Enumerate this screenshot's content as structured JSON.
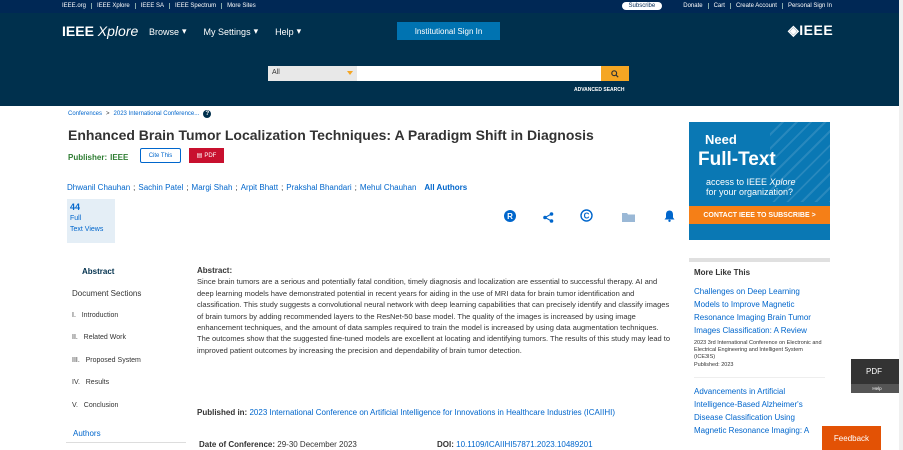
{
  "util_bar": {
    "links": [
      "IEEE.org",
      "IEEE Xplore",
      "IEEE SA",
      "IEEE Spectrum",
      "More Sites"
    ],
    "subscribe": "Subscribe",
    "right_links": [
      "Donate",
      "Cart",
      "Create Account",
      "Personal Sign In"
    ]
  },
  "header": {
    "logo_main": "IEEE ",
    "logo_italic": "Xplore",
    "nav": [
      "Browse",
      "My Settings",
      "Help"
    ],
    "institutional_sign_in": "Institutional Sign In",
    "brand": "◈IEEE"
  },
  "search": {
    "scope": "All",
    "placeholder": "",
    "advanced": "ADVANCED SEARCH"
  },
  "breadcrumb": [
    "Conferences",
    ">",
    "2023 International Conference..."
  ],
  "article": {
    "title": "Enhanced Brain Tumor Localization Techniques: A Paradigm Shift in Diagnosis",
    "publisher_label": "Publisher:",
    "publisher": "IEEE",
    "cite_this": "Cite This",
    "pdf": "PDF",
    "authors": [
      "Dhwanil Chauhan",
      "Sachin Patel",
      "Margi Shah",
      "Arpit Bhatt",
      "Prakshal Bhandari",
      "Mehul Chauhan"
    ],
    "all_authors": "All Authors",
    "views_count": "44",
    "views_label1": "Full",
    "views_label2": "Text Views"
  },
  "ad": {
    "line1": "Need",
    "line2": "Full-Text",
    "line3a": "access to IEEE",
    "line3b": "Xplore",
    "line4": "for your organization?",
    "cta": "CONTACT IEEE TO SUBSCRIBE >"
  },
  "left_nav": {
    "abstract": "Abstract",
    "doc_sections": "Document Sections",
    "sections": [
      "I.   Introduction",
      "II.   Related Work",
      "III.   Proposed System",
      "IV.   Results",
      "V.   Conclusion"
    ],
    "authors": "Authors"
  },
  "abstract": {
    "heading": "Abstract:",
    "text": "Since brain tumors are a serious and potentially fatal condition, timely diagnosis and localization are essential to successful therapy. AI and deep learning models have demonstrated potential in recent years for aiding in the use of MRI data for brain tumor identification and classification. This study suggests a convolutional neural network with deep learning capabilities that can precisely identify and classify images of brain tumors by adding recommended layers to the ResNet-50 base model. The quality of the images is increased by using image enhancement techniques, and the amount of data samples required to train the model is increased by using data augmentation techniques. The outcomes show that the suggested fine-tuned models are excellent at locating and identifying tumors. The results of this study may lead to improved patient outcomes by increasing the precision and dependability of brain tumor detection.",
    "published_label": "Published in:",
    "published_in": "2023 International Conference on Artificial Intelligence for Innovations in Healthcare Industries (ICAIIHI)",
    "date_label": "Date of Conference:",
    "date": "29-30 December 2023",
    "doi_label": "DOI:",
    "doi": "10.1109/ICAIIHI57871.2023.10489201"
  },
  "more_like_this": {
    "heading": "More Like This",
    "item1_title": "Challenges on Deep Learning Models to Improve Magnetic Resonance Imaging Brain Tumor Images Classification: A Review",
    "item1_meta": "2023 3rd International Conference on Electronic and Electrical Engineering and Intelligent System (ICE3IS)",
    "item1_date": "Published: 2023",
    "item2_title": "Advancements in Artificial Intelligence-Based Alzheimer's Disease Classification Using Magnetic Resonance Imaging: A"
  },
  "side": {
    "pdf": "PDF",
    "help": "Help",
    "feedback": "Feedback"
  },
  "colors": {
    "header_bg": "#00304d",
    "link": "#0066cc",
    "accent": "#f5a623",
    "pdf_red": "#c8102e"
  }
}
